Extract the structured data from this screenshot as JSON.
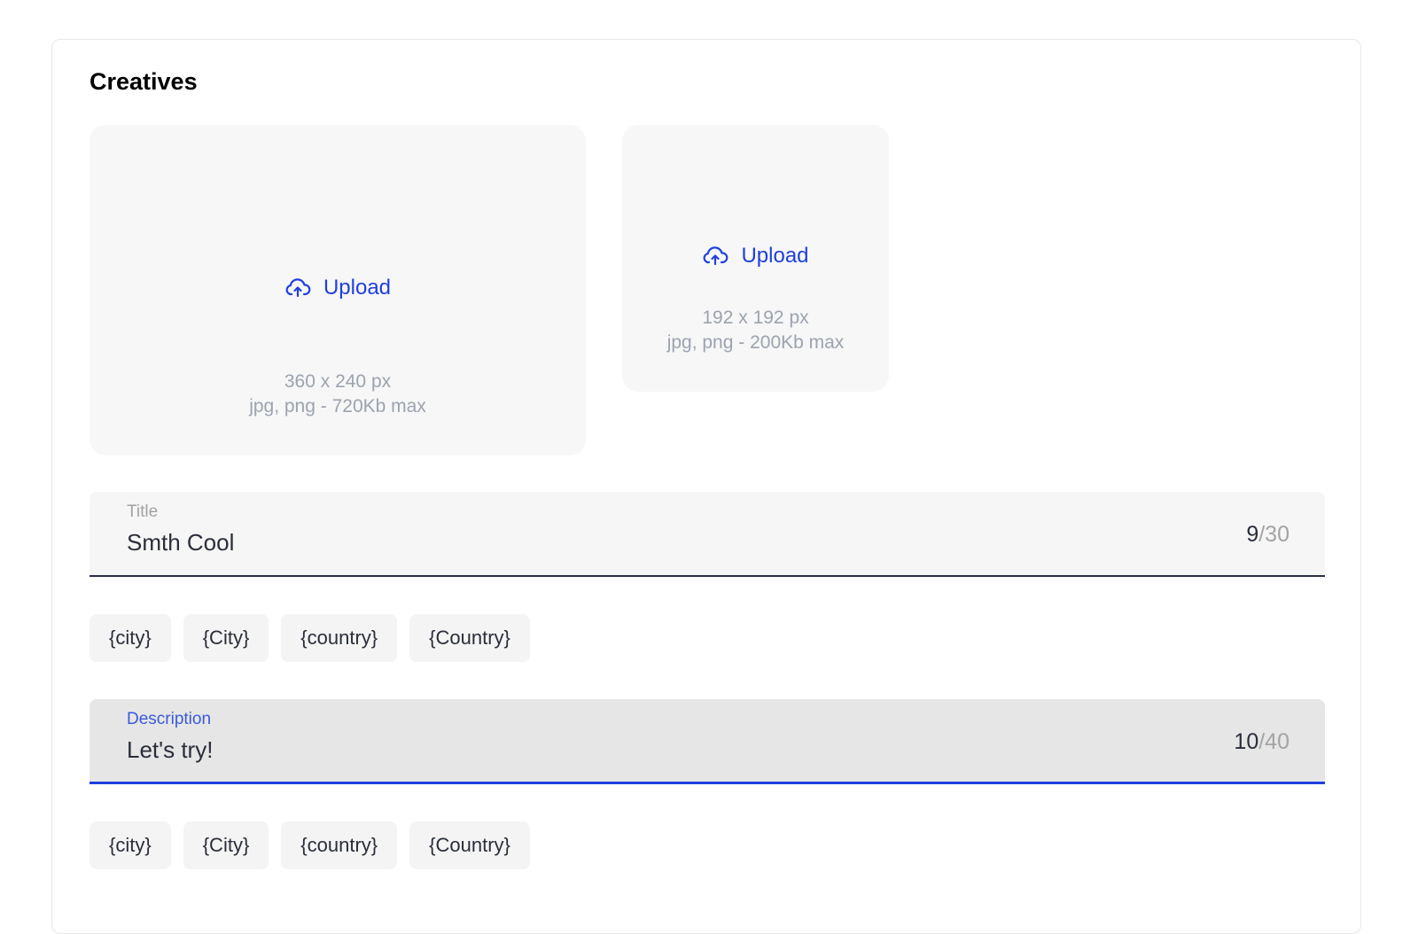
{
  "section": {
    "title": "Creatives"
  },
  "uploads": [
    {
      "label": "Upload",
      "dimensions": "360 x 240 px",
      "formats": "jpg, png - 720Kb max"
    },
    {
      "label": "Upload",
      "dimensions": "192 x 192 px",
      "formats": "jpg, png - 200Kb max"
    }
  ],
  "title_field": {
    "label": "Title",
    "value": "Smth Cool",
    "count": "9",
    "max": "/30"
  },
  "title_chips": [
    "{city}",
    "{City}",
    "{country}",
    "{Country}"
  ],
  "description_field": {
    "label": "Description",
    "value": "Let's try!",
    "count": "10",
    "max": "/40"
  },
  "description_chips": [
    "{city}",
    "{City}",
    "{country}",
    "{Country}"
  ],
  "colors": {
    "accent": "#1e3fe0",
    "muted_text": "#9ca3af",
    "dropzone_bg": "#f7f7f7"
  },
  "icons": {
    "upload": "cloud-upload-icon"
  }
}
